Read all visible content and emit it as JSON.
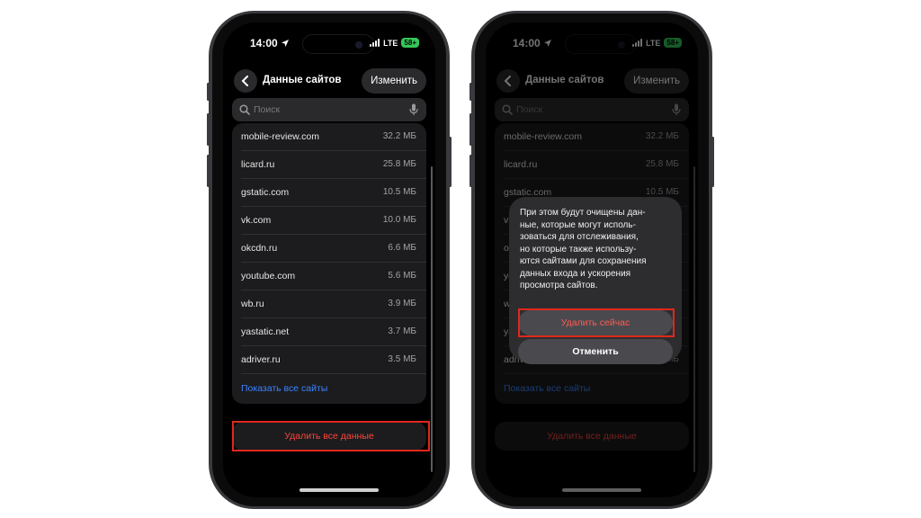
{
  "status_bar": {
    "time": "14:00",
    "network": "LTE",
    "battery": "58+"
  },
  "colors": {
    "accent_blue": "#3a84ff",
    "destructive_red": "#ff453a",
    "highlight_red": "#e0281b",
    "battery_green": "#34c759"
  },
  "nav": {
    "title": "Данные сайтов",
    "edit_label": "Изменить",
    "back_icon": "chevron-left-icon"
  },
  "search": {
    "placeholder": "Поиск",
    "icon": "search-icon",
    "mic_icon": "mic-icon"
  },
  "sites": [
    {
      "site": "mobile-review.com",
      "size": "32.2 МБ"
    },
    {
      "site": "licard.ru",
      "size": "25.8 МБ"
    },
    {
      "site": "gstatic.com",
      "size": "10.5 МБ"
    },
    {
      "site": "vk.com",
      "size": "10.0 МБ"
    },
    {
      "site": "okcdn.ru",
      "size": "6.6 МБ"
    },
    {
      "site": "youtube.com",
      "size": "5.6 МБ"
    },
    {
      "site": "wb.ru",
      "size": "3.9 МБ"
    },
    {
      "site": "yastatic.net",
      "size": "3.7 МБ"
    },
    {
      "site": "adriver.ru",
      "size": "3.5 МБ"
    }
  ],
  "show_all_label": "Показать все сайты",
  "delete_all_label": "Удалить все данные",
  "alert": {
    "message_lines": [
      "При этом будут очищены дан-",
      "ные, которые могут исполь-",
      "зоваться для отслеживания,",
      "но которые также использу-",
      "ются сайтами для сохранения",
      "данных входа и ускорения",
      "просмотра сайтов."
    ],
    "delete_now_label": "Удалить сейчас",
    "cancel_label": "Отменить"
  }
}
